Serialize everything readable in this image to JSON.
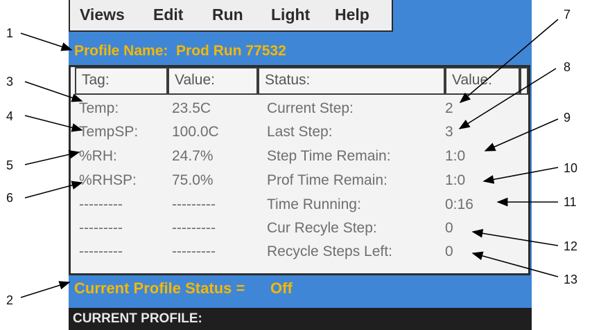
{
  "menu": {
    "items": [
      "Views",
      "Edit",
      "Run",
      "Light",
      "Help"
    ]
  },
  "profile_name": "Profile Name:  Prod Run 77532",
  "table": {
    "headers": [
      "Tag:",
      "Value:",
      "Status:",
      "Value:"
    ],
    "rows": [
      [
        "Temp:",
        "23.5C",
        "Current Step:",
        "2"
      ],
      [
        "TempSP:",
        "100.0C",
        "Last Step:",
        "3"
      ],
      [
        "%RH:",
        "24.7%",
        "Step Time Remain:",
        "1:0"
      ],
      [
        "%RHSP:",
        "75.0%",
        "Prof Time Remain:",
        "1:0"
      ],
      [
        "---------",
        "---------",
        "Time Running:",
        "0:16"
      ],
      [
        "---------",
        "---------",
        "Cur Recyle Step:",
        "0"
      ],
      [
        "---------",
        "---------",
        "Recycle Steps Left:",
        "0"
      ]
    ]
  },
  "status_line": "Current Profile Status =      Off",
  "bottom_label": "CURRENT PROFILE:",
  "callouts": [
    "1",
    "2",
    "3",
    "4",
    "5",
    "6",
    "7",
    "8",
    "9",
    "10",
    "11",
    "12",
    "13"
  ],
  "colors": {
    "screen_bg": "#3f86d6",
    "accent_text": "#f5b800",
    "panel_bg": "#f3f3f3",
    "bottom_bar": "#1f1f1f"
  }
}
